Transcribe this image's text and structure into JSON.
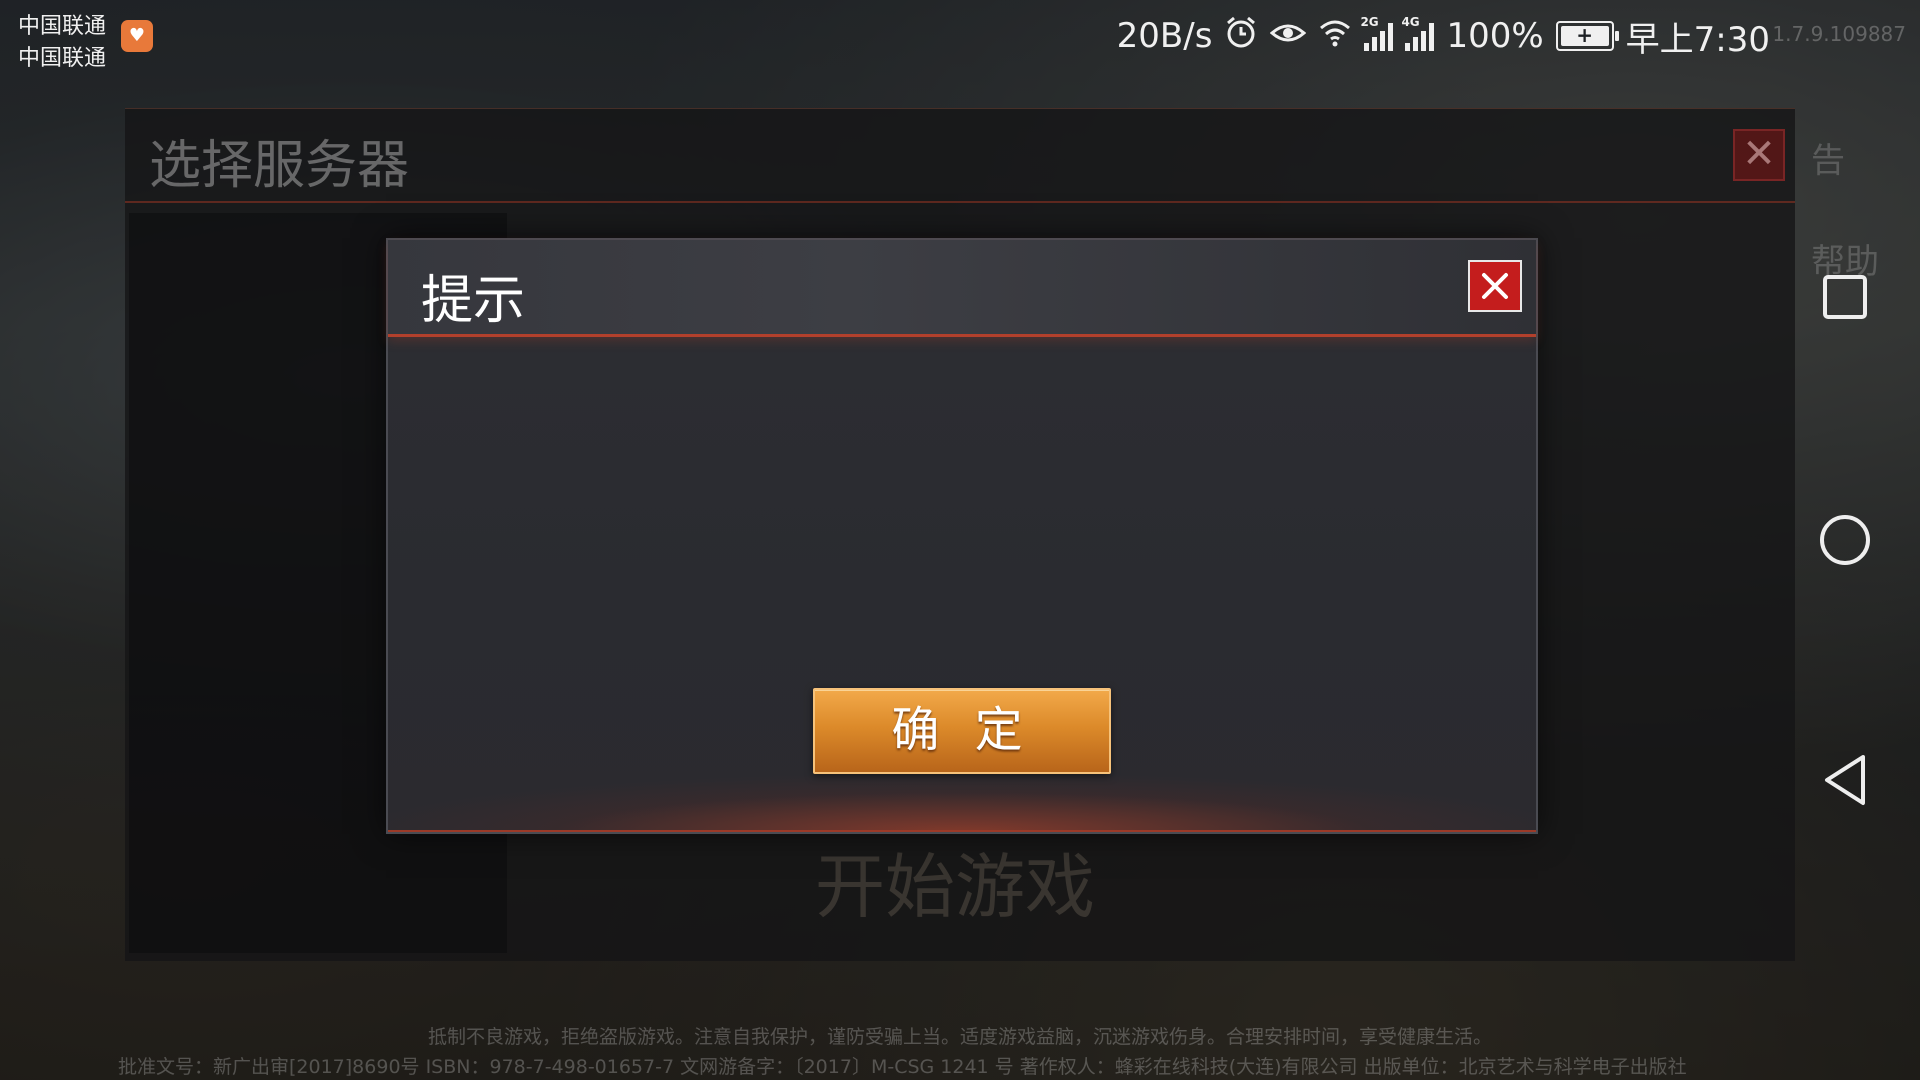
{
  "status_bar": {
    "carrier_1": "中国联通",
    "carrier_2": "中国联通",
    "net_speed": "20B/s",
    "signal_1_tag": "2G",
    "signal_2_tag": "4G",
    "battery_percent": "100%",
    "time": "早上7:30",
    "version": "1.7.9.109887"
  },
  "background_panel": {
    "title": "选择服务器",
    "start_game_label": "开始游戏",
    "help_label": "帮助",
    "announce_label": "告"
  },
  "dialog": {
    "title": "提示",
    "message": "",
    "confirm_label": "确 定"
  },
  "footer": {
    "notice": "抵制不良游戏，拒绝盗版游戏。注意自我保护，谨防受骗上当。适度游戏益脑，沉迷游戏伤身。合理安排时间，享受健康生活。",
    "license": "批准文号：新广出审[2017]8690号    ISBN：978-7-498-01657-7    文网游备字：〔2017〕M-CSG 1241 号    著作权人：蜂彩在线科技(大连)有限公司    出版单位：北京艺术与科学电子出版社"
  },
  "colors": {
    "dialog_accent": "#b2402c",
    "close_red": "#c41d1d",
    "confirm_orange": "#dc8a2a"
  }
}
